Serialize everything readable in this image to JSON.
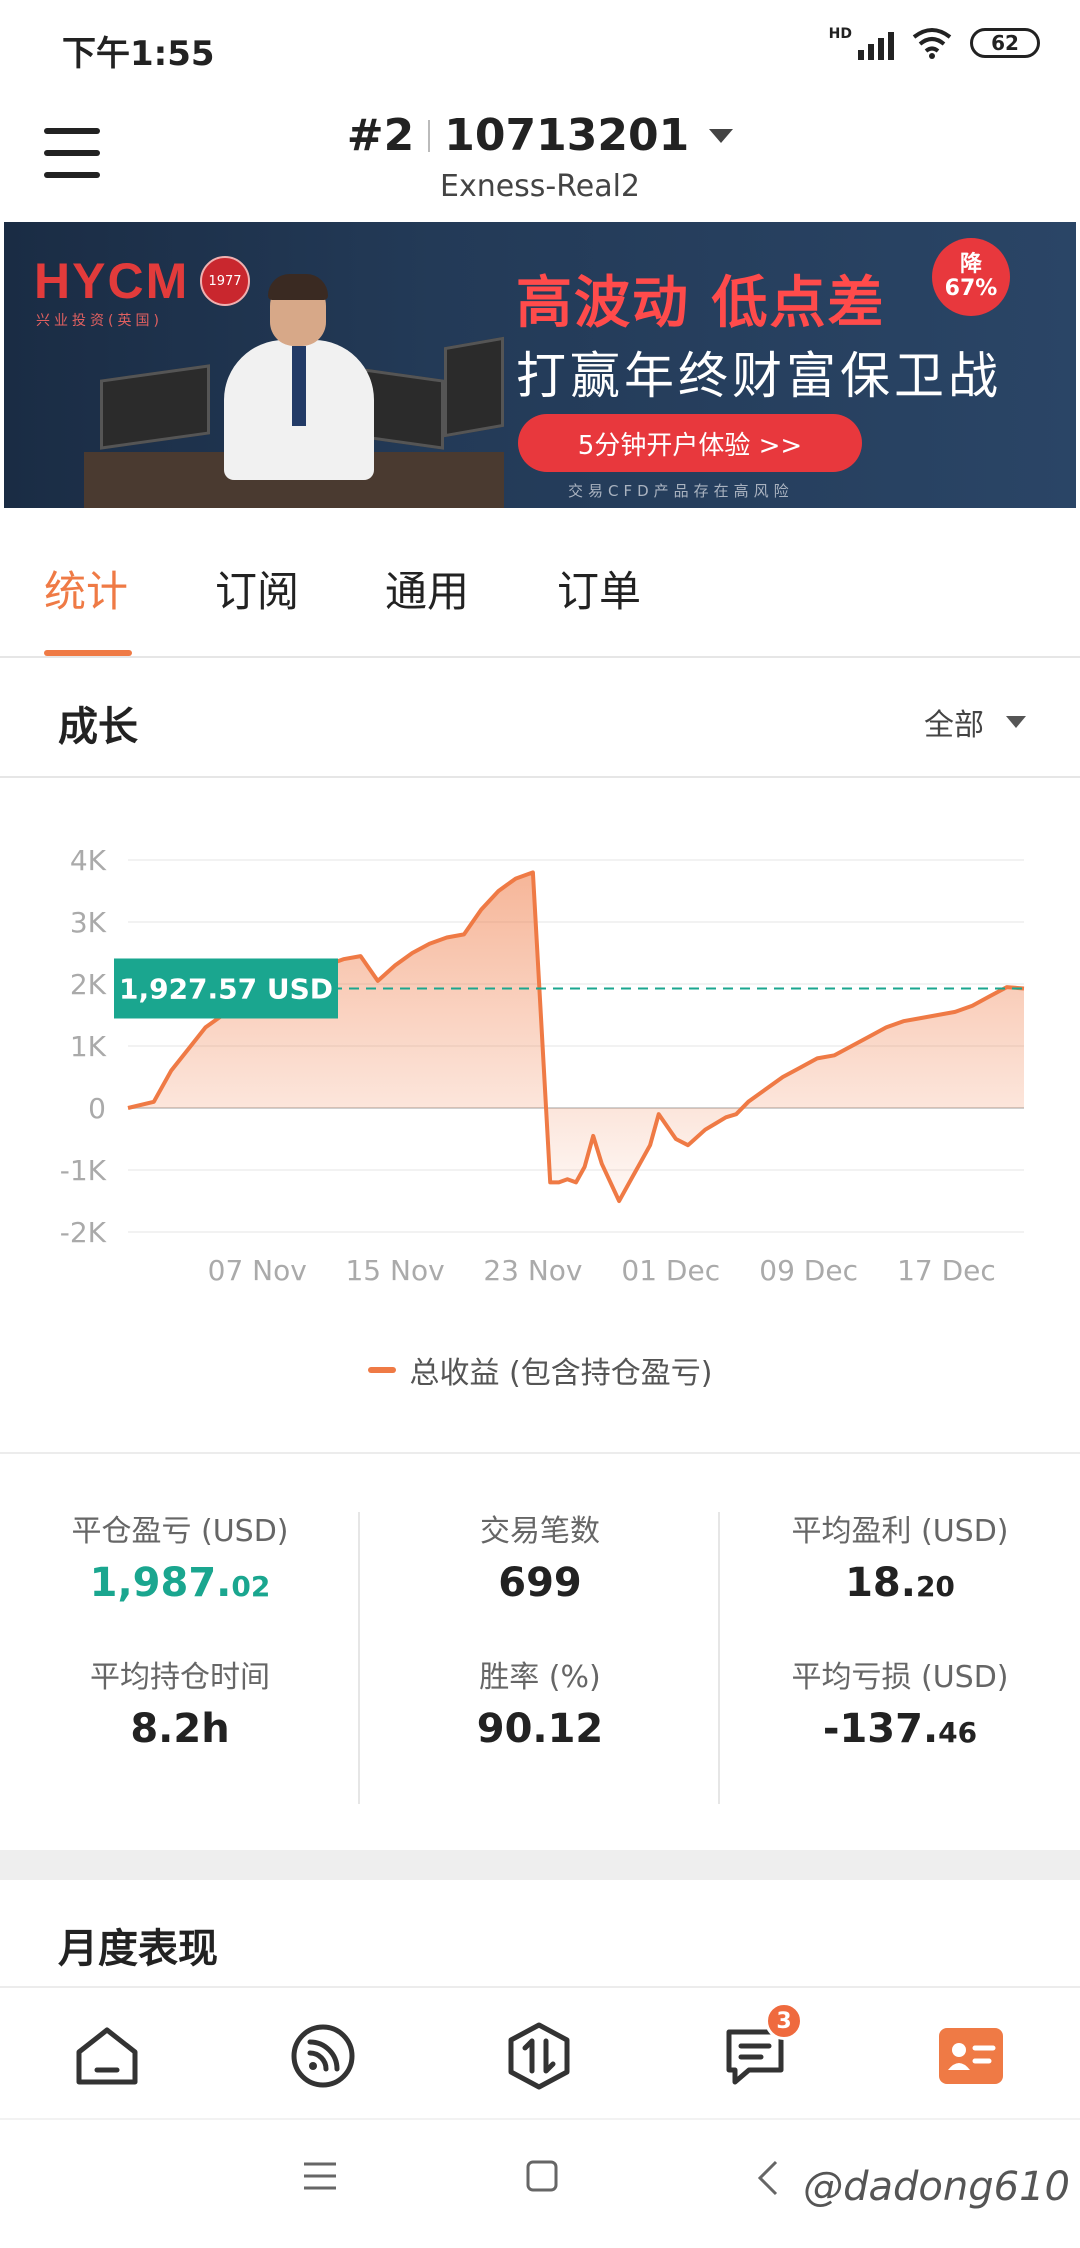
{
  "status_bar": {
    "time": "下午1:55",
    "network": "HD",
    "battery": "62"
  },
  "header": {
    "account_prefix": "#2",
    "account_number": "10713201",
    "server": "Exness-Real2"
  },
  "banner": {
    "logo": "HYCM",
    "logo_sub": "兴业投资(英国)",
    "seal": "1977",
    "headline": "高波动 低点差",
    "subline": "打赢年终财富保卫战",
    "badge_top": "降",
    "badge_bottom": "67%",
    "cta": "5分钟开户体验 >>",
    "disclaimer": "交易CFD产品存在高风险"
  },
  "tabs": [
    {
      "label": "统计",
      "active": true
    },
    {
      "label": "订阅",
      "active": false
    },
    {
      "label": "通用",
      "active": false
    },
    {
      "label": "订单",
      "active": false
    }
  ],
  "growth": {
    "title": "成长",
    "filter": "全部"
  },
  "chart_data": {
    "type": "area",
    "current_value_label": "1,927.57 USD",
    "current_value": 1927.57,
    "y_ticks": [
      "4K",
      "3K",
      "2K",
      "1K",
      "0",
      "-1K",
      "-2K"
    ],
    "ylim": [
      -2000,
      4000
    ],
    "x_ticks": [
      "07 Nov",
      "15 Nov",
      "23 Nov",
      "01 Dec",
      "09 Dec",
      "17 Dec"
    ],
    "x_tick_day_offsets": [
      7,
      15,
      23,
      31,
      39,
      47
    ],
    "grid": true,
    "series": [
      {
        "name": "总收益 (包含持仓盈亏)",
        "color": "#ef7a45",
        "x": [
          -0.5,
          1,
          2,
          3,
          4,
          5,
          6,
          7,
          8,
          9,
          10,
          11,
          12,
          13,
          14,
          15,
          16,
          17,
          18,
          19,
          20,
          21,
          21.5,
          22,
          23,
          24,
          24.5,
          25,
          25.5,
          26,
          26.5,
          27,
          28,
          29,
          29.8,
          30.3,
          31.3,
          32,
          33,
          33.6,
          34.2,
          34.8,
          35.5,
          36.5,
          37.5,
          38.5,
          39.5,
          40.5,
          41.5,
          42.5,
          43.5,
          44.5,
          45.5,
          46.5,
          47.5,
          48.5,
          49.5,
          50.5,
          51.5
        ],
        "values": [
          0,
          100,
          600,
          950,
          1300,
          1500,
          1500,
          1700,
          1900,
          2000,
          2200,
          2300,
          2400,
          2450,
          2050,
          2300,
          2500,
          2650,
          2750,
          2800,
          3200,
          3500,
          3600,
          3700,
          3800,
          -1200,
          -1200,
          -1150,
          -1200,
          -950,
          -450,
          -900,
          -1500,
          -1000,
          -600,
          -100,
          -500,
          -600,
          -350,
          -250,
          -150,
          -100,
          100,
          300,
          500,
          650,
          800,
          850,
          1000,
          1150,
          1300,
          1400,
          1450,
          1500,
          1550,
          1650,
          1800,
          1950,
          1927.57
        ]
      }
    ]
  },
  "stats": {
    "closed_pnl_label": "平仓盈亏 (USD)",
    "closed_pnl_int": "1,987.",
    "closed_pnl_dec": "02",
    "trades_label": "交易笔数",
    "trades": "699",
    "avg_profit_label": "平均盈利 (USD)",
    "avg_profit_int": "18.",
    "avg_profit_dec": "20",
    "avg_hold_label": "平均持仓时间",
    "avg_hold": "8.2h",
    "win_rate_label": "胜率 (%)",
    "win_rate": "90.12",
    "avg_loss_label": "平均亏损 (USD)",
    "avg_loss_int": "-137.",
    "avg_loss_dec": "46"
  },
  "monthly": {
    "title": "月度表现"
  },
  "bottom_nav": {
    "messages_badge": "3"
  },
  "watermark": "@dadong610"
}
